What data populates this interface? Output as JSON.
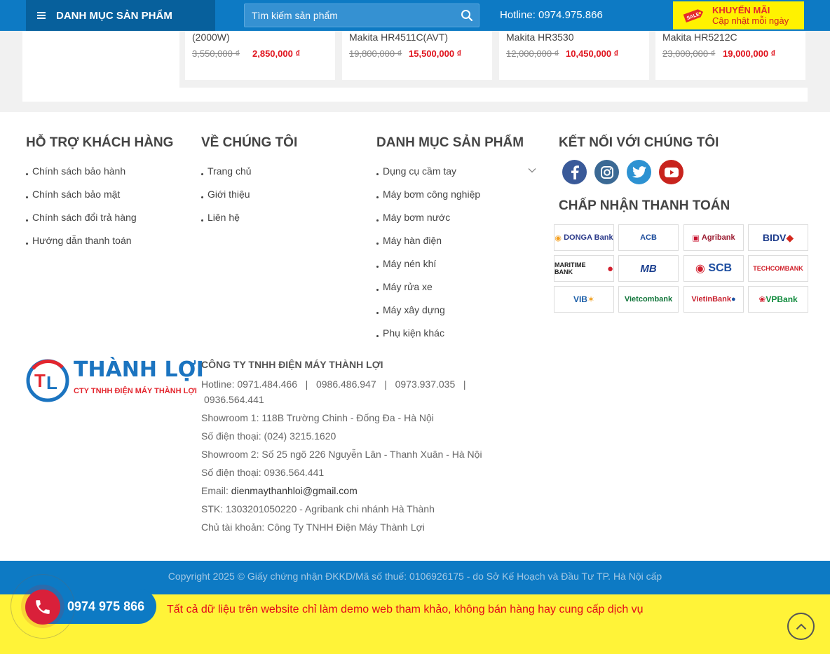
{
  "header": {
    "category_label": "DANH MỤC SẢN PHẨM",
    "search_placeholder": "Tìm kiếm sản phẩm",
    "hotline": "Hotline: 0974.975.866",
    "promo_title": "KHUYẾN MÃI",
    "promo_sub": "Cập nhật mỗi ngày",
    "promo_tag": "SALE"
  },
  "products": [
    {
      "name": "(2000W)",
      "old_price": "3,550,000 ₫",
      "new_price": "2,850,000 ₫"
    },
    {
      "name": "Makita HR4511C(AVT)",
      "old_price": "19,800,000 ₫",
      "new_price": "15,500,000 ₫"
    },
    {
      "name": "Makita HR3530",
      "old_price": "12,000,000 ₫",
      "new_price": "10,450,000 ₫"
    },
    {
      "name": "Makita HR5212C",
      "old_price": "23,000,000 ₫",
      "new_price": "19,000,000 ₫"
    }
  ],
  "footer": {
    "support": {
      "title": "HỖ TRỢ KHÁCH HÀNG",
      "links": [
        "Chính sách bảo hành",
        "Chính sách bảo mật",
        "Chính sách đổi trả hàng",
        "Hướng dẫn thanh toán"
      ]
    },
    "about": {
      "title": "VỀ CHÚNG TÔI",
      "links": [
        "Trang chủ",
        "Giới thiệu",
        "Liên hệ"
      ]
    },
    "categories": {
      "title": "DANH MỤC SẢN PHẨM",
      "links": [
        "Dụng cụ cầm tay",
        "Máy bơm công nghiệp",
        "Máy bơm nước",
        "Máy hàn điện",
        "Máy nén khí",
        "Máy rửa xe",
        "Máy xây dựng",
        "Phụ kiện khác"
      ]
    },
    "connect_title": "KẾT NỐI VỚI CHÚNG TÔI",
    "payment_title": "CHẤP NHẬN THANH TOÁN",
    "banks": [
      "DONGA Bank",
      "ACB",
      "Agribank",
      "BIDV",
      "MARITIME BANK",
      "MB",
      "SCB",
      "TECHCOMBANK",
      "VIB",
      "Vietcombank",
      "VietinBank",
      "VPBank"
    ],
    "logo": {
      "title": "THÀNH LỢI",
      "subtitle": "CTY TNHH ĐIỆN MÁY THÀNH LỢI"
    },
    "company": {
      "name": "CÔNG TY TNHH ĐIỆN MÁY THÀNH LỢI",
      "hotline_label": "Hotline:",
      "hotlines": "0971.484.466   |   0986.486.947   |   0973.937.035   |",
      "hotline_last": "0936.564.441",
      "showroom1": "Showroom 1: 118B Trường Chinh - Đống Đa - Hà Nội",
      "phone1": "Số điện thoại: (024) 3215.1620",
      "showroom2": "Showroom 2: Số 25 ngõ 226 Nguyễn Lân - Thanh Xuân - Hà Nội",
      "phone2": "Số điện thoại: 0936.564.441",
      "email_label": "Email: ",
      "email": "dienmaythanhloi@gmail.com",
      "account": "STK: 1303201050220 - Agribank chi nhánh Hà Thành",
      "owner": "Chủ tài khoản: Công Ty TNHH Điện Máy Thành Lợi"
    }
  },
  "copyright": "Copyright 2025 © Giấy chứng nhận ĐKKD/Mã số thuế: 0106926175 - do Sở Kế Hoạch và Đầu Tư TP. Hà Nội cấp",
  "notice": "Tất cả dữ liệu trên website chỉ làm demo web tham khảo, không bán hàng hay cung cấp dịch vụ",
  "call_number": "0974 975 866",
  "colors": {
    "brand": "#0d7ac4",
    "brand_dark": "#07609c",
    "price": "#e0141e",
    "notice_bg": "#fff338",
    "call": "#d9203a"
  }
}
